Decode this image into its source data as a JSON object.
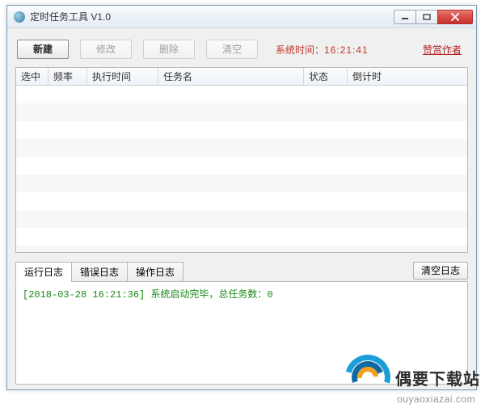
{
  "window": {
    "title": "定时任务工具 V1.0"
  },
  "toolbar": {
    "new_label": "新建",
    "edit_label": "修改",
    "delete_label": "删除",
    "clear_label": "清空",
    "systime_label": "系统时间：",
    "systime_value": "16:21:41",
    "sponsor_label": "赞赏作者"
  },
  "grid": {
    "columns": {
      "checked": "选中",
      "freq": "频率",
      "exec_time": "执行时间",
      "task_name": "任务名",
      "status": "状态",
      "countdown": "倒计时"
    },
    "rows": []
  },
  "logs": {
    "tabs": {
      "run": "运行日志",
      "error": "错误日志",
      "op": "操作日志"
    },
    "clear_label": "清空日志",
    "entries": [
      {
        "timestamp": "[2018-03-28 16:21:36]",
        "message": " 系统启动完毕，总任务数：0"
      }
    ]
  },
  "watermark": {
    "site_name": "偶要下载站",
    "site_url": "ouyaoxiazai.com"
  }
}
